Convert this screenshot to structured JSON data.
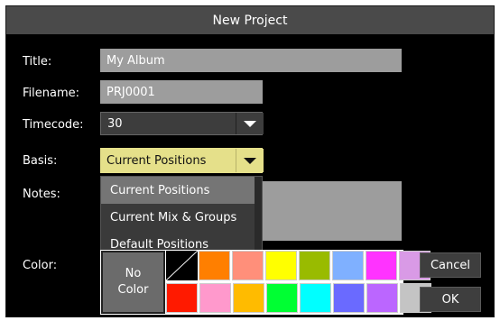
{
  "dialog": {
    "title": "New Project"
  },
  "form": {
    "title_label": "Title:",
    "title_value": "My Album",
    "filename_label": "Filename:",
    "filename_value": "PRJ0001",
    "timecode_label": "Timecode:",
    "timecode_value": "30",
    "basis_label": "Basis:",
    "basis_value": "Current Positions",
    "notes_label": "Notes:",
    "color_label": "Color:"
  },
  "basis_options": [
    "Current Positions",
    "Current Mix & Groups",
    "Default Positions"
  ],
  "palette": {
    "no_color_line1": "No",
    "no_color_line2": "Color",
    "row1": [
      "#ff7f00",
      "#ff8f7a",
      "#ffff00",
      "#99bb00",
      "#7fb0ff",
      "#ff33ff",
      "#d99ae6"
    ],
    "row2": [
      "#ff1a00",
      "#ff99cc",
      "#ffbb00",
      "#00ff33",
      "#00ffff",
      "#6a6aff",
      "#bb66ff",
      "#c4c4c4"
    ]
  },
  "buttons": {
    "cancel": "Cancel",
    "ok": "OK"
  },
  "colors": {
    "title_bar": "#4a4a4a",
    "field_bg": "#9d9d9d",
    "basis_bg": "#e5e08a",
    "dropdown_selected": "#757575"
  }
}
